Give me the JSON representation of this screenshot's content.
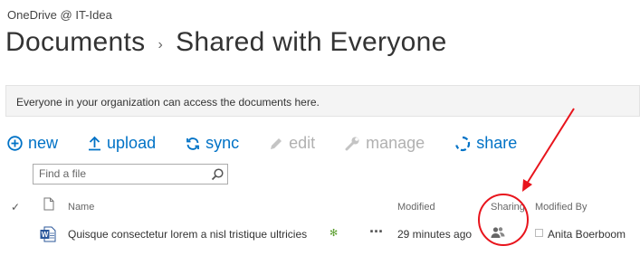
{
  "site": {
    "title": "OneDrive @ IT-Idea"
  },
  "breadcrumb": {
    "root": "Documents",
    "separator": "›",
    "current": "Shared with Everyone"
  },
  "notice": {
    "text": "Everyone in your organization can access the documents here."
  },
  "toolbar": {
    "new": "new",
    "upload": "upload",
    "sync": "sync",
    "edit": "edit",
    "manage": "manage",
    "share": "share"
  },
  "search": {
    "placeholder": "Find a file"
  },
  "columns": {
    "check": "✓",
    "name": "Name",
    "modified": "Modified",
    "sharing": "Sharing",
    "modified_by": "Modified By"
  },
  "rows": [
    {
      "name": "Quisque consectetur lorem a nisl tristique ultricies",
      "new_marker": "✻",
      "menu": "···",
      "modified": "29 minutes ago",
      "sharing_icon": "people-icon",
      "modified_by": "Anita Boerboom"
    }
  ],
  "colors": {
    "accent": "#0072c6",
    "disabled": "#b1b1b1",
    "annotation": "#e8141c",
    "new_marker": "#5a9e2e"
  }
}
